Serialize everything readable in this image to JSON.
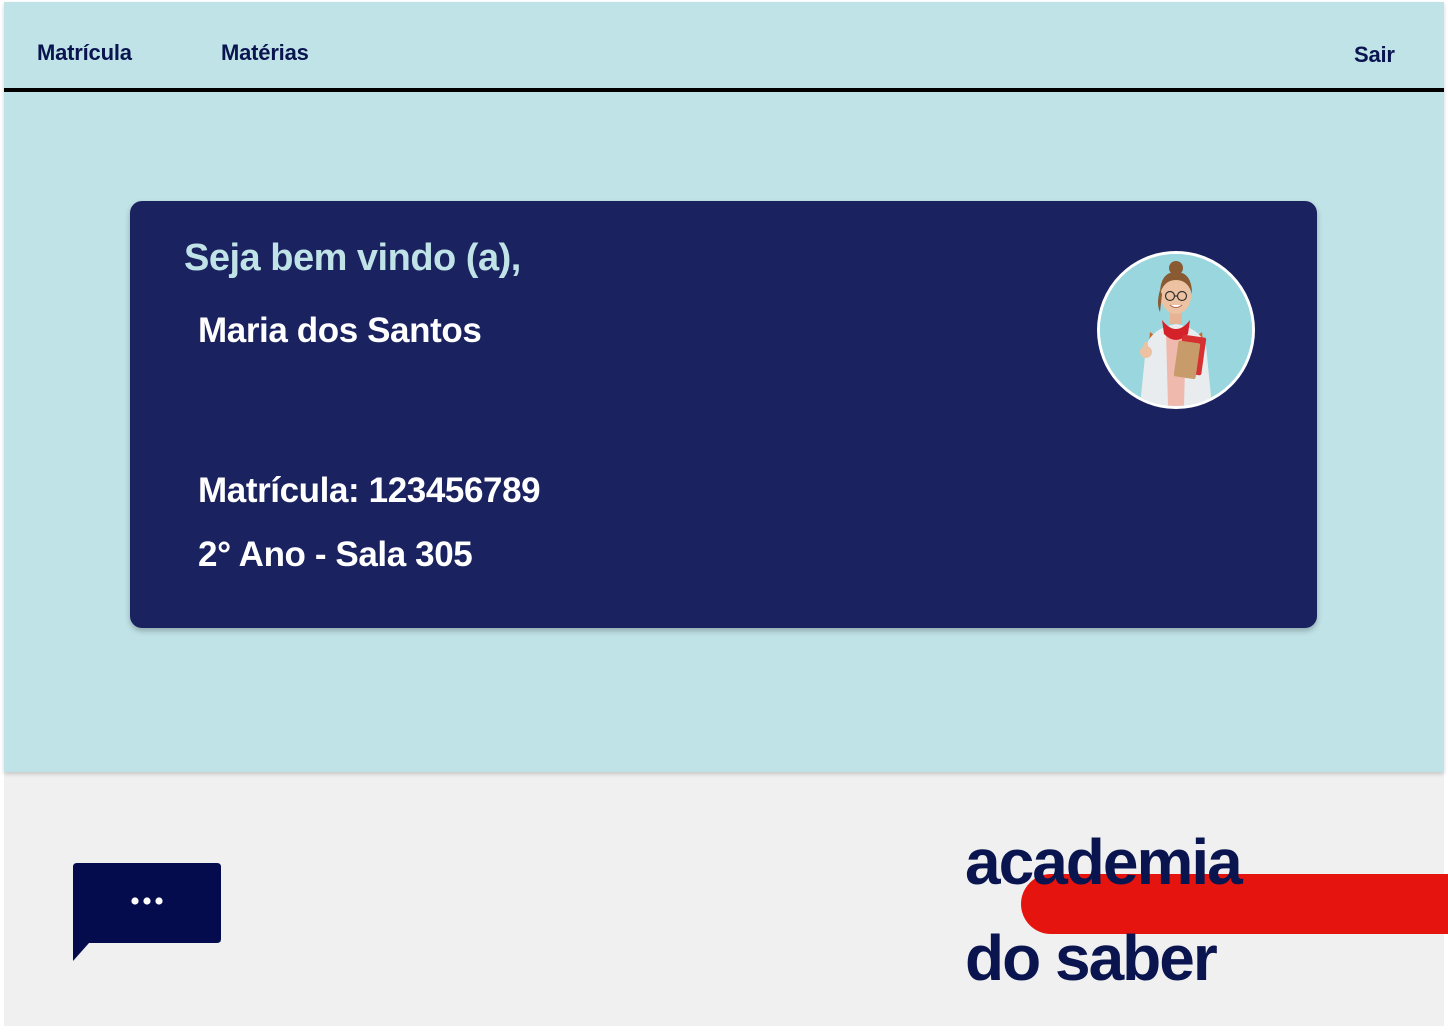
{
  "nav": {
    "items": [
      "Matrícula",
      "Matérias"
    ],
    "logout_label": "Sair"
  },
  "welcome_card": {
    "greeting": "Seja bem vindo (a),",
    "student_name": "Maria dos Santos",
    "enrollment": "Matrícula: 123456789",
    "grade_room": "2° Ano - Sala 305"
  },
  "avatar_icon": "student-photo-icon",
  "chat_icon": "chat-bubble-ellipsis-icon",
  "logo": {
    "line1": "academia",
    "line2": "do saber"
  },
  "colors": {
    "page_background": "#c0e3e7",
    "card_background": "#1a2260",
    "greeting_text": "#c0e3e7",
    "nav_text": "#0a1550",
    "logo_accent": "#e5140f",
    "footer_background": "#f0f0f0"
  }
}
